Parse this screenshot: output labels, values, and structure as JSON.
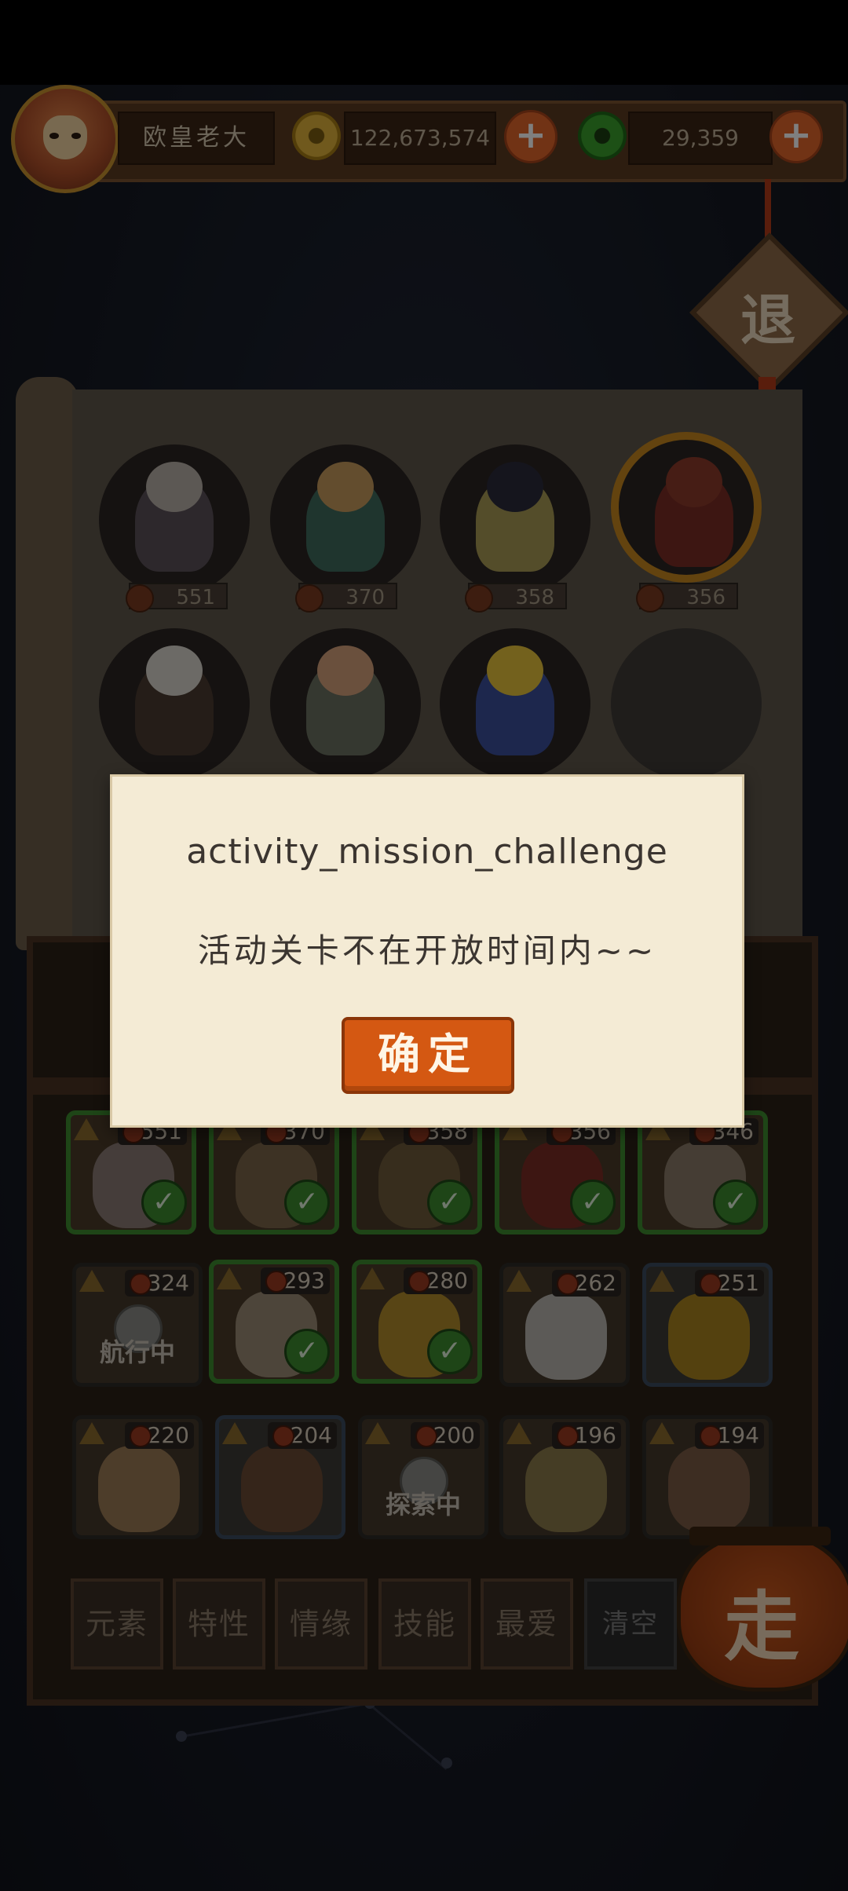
{
  "player": {
    "name": "欧皇老大"
  },
  "currency": {
    "gold": "122,673,574",
    "jade": "29,359"
  },
  "exit": {
    "label": "退"
  },
  "featured": [
    {
      "power": "551"
    },
    {
      "power": "370"
    },
    {
      "power": "358"
    },
    {
      "power": "356"
    }
  ],
  "pets": [
    {
      "power": "551",
      "selected": true
    },
    {
      "power": "370",
      "selected": true
    },
    {
      "power": "358",
      "selected": true
    },
    {
      "power": "356",
      "selected": true
    },
    {
      "power": "346",
      "selected": true
    },
    {
      "power": "324",
      "status": "航行中"
    },
    {
      "power": "293",
      "selected": true
    },
    {
      "power": "280",
      "selected": true
    },
    {
      "power": "262"
    },
    {
      "power": "251"
    },
    {
      "power": "220"
    },
    {
      "power": "204"
    },
    {
      "power": "200",
      "status": "探索中"
    },
    {
      "power": "196"
    },
    {
      "power": "194"
    }
  ],
  "filters": [
    "元素",
    "特性",
    "情缘",
    "技能",
    "最爱",
    "清空"
  ],
  "go": {
    "label": "走"
  },
  "dialog": {
    "title": "activity_mission_challenge",
    "message": "活动关卡不在开放时间内~~",
    "confirm": "确定"
  }
}
